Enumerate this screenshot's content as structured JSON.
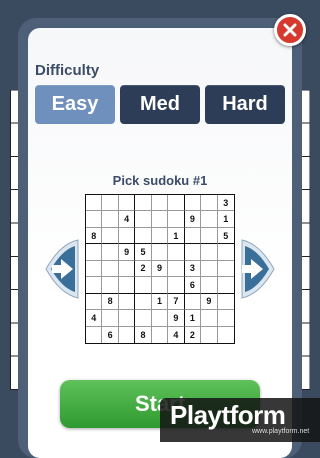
{
  "difficulty": {
    "title": "Difficulty",
    "options": [
      "Easy",
      "Med",
      "Hard"
    ],
    "selected": "Easy"
  },
  "picker": {
    "label": "Pick sudoku #1"
  },
  "grid": [
    [
      "",
      "",
      "",
      "",
      "",
      "",
      "",
      "",
      "3"
    ],
    [
      "",
      "",
      "4",
      "",
      "",
      "",
      "9",
      "",
      "1"
    ],
    [
      "8",
      "",
      "",
      "",
      "",
      "1",
      "",
      "",
      "5"
    ],
    [
      "",
      "",
      "9",
      "5",
      "",
      "",
      "",
      "",
      ""
    ],
    [
      "",
      "",
      "",
      "2",
      "9",
      "",
      "3",
      "",
      ""
    ],
    [
      "",
      "",
      "",
      "",
      "",
      "",
      "6",
      "",
      ""
    ],
    [
      "",
      "8",
      "",
      "",
      "1",
      "7",
      "",
      "9",
      ""
    ],
    [
      "4",
      "",
      "",
      "",
      "",
      "9",
      "1",
      "",
      ""
    ],
    [
      "",
      "6",
      "",
      "8",
      "",
      "4",
      "2",
      "",
      ""
    ]
  ],
  "start_label": "Start",
  "watermark": {
    "text": "Playtform",
    "url": "www.playtform.net"
  },
  "colors": {
    "selected": "#6f8fbd",
    "button": "#2d3d57",
    "close": "#d63a2f",
    "start": "#3aa53a",
    "arrow": "#3a6f9a"
  }
}
